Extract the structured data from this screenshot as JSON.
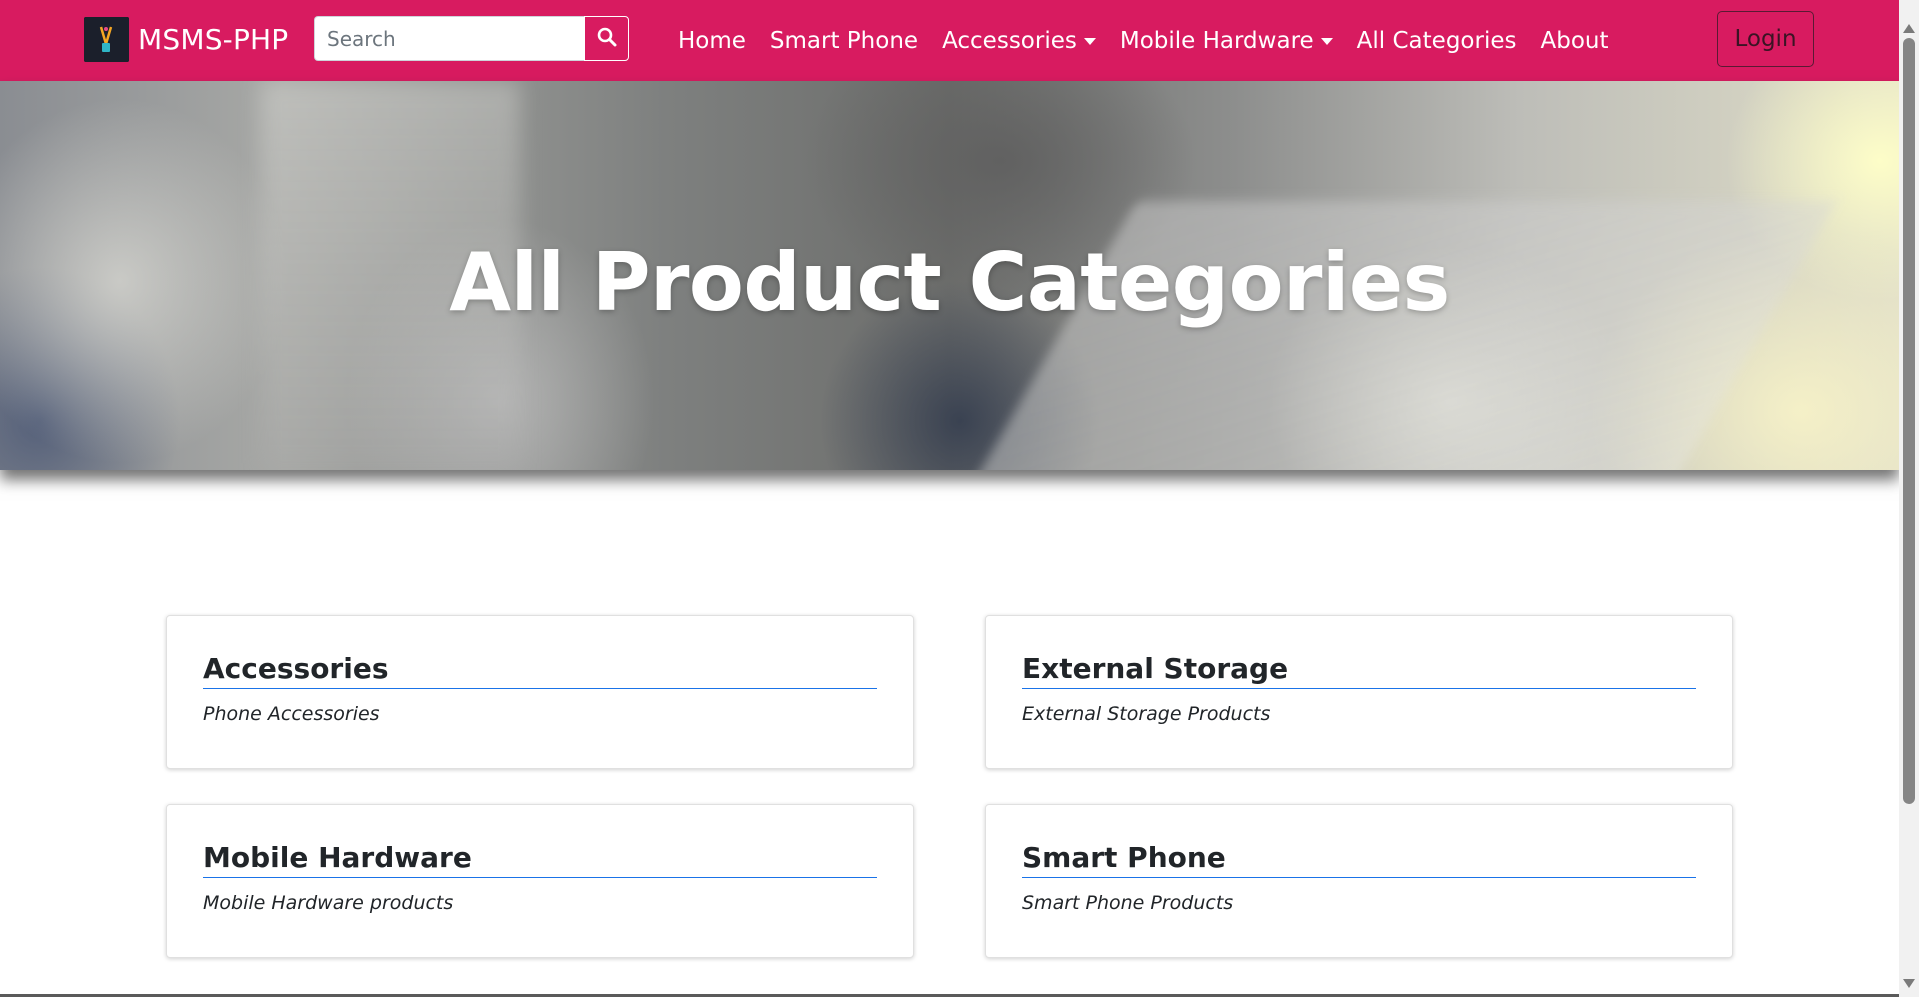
{
  "navbar": {
    "brand": "MSMS-PHP",
    "search": {
      "placeholder": "Search",
      "value": ""
    },
    "links": [
      {
        "label": "Home"
      },
      {
        "label": "Smart Phone"
      },
      {
        "label": "Accessories",
        "dropdown": true
      },
      {
        "label": "Mobile Hardware",
        "dropdown": true
      },
      {
        "label": "All Categories"
      },
      {
        "label": "About"
      }
    ],
    "login_label": "Login",
    "bg_color": "#d81b60"
  },
  "hero": {
    "title": "All Product Categories"
  },
  "categories": [
    {
      "title": "Accessories",
      "description": "Phone Accessories"
    },
    {
      "title": "External Storage",
      "description": "External Storage Products"
    },
    {
      "title": "Mobile Hardware",
      "description": "Mobile Hardware products"
    },
    {
      "title": "Smart Phone",
      "description": "Smart Phone Products"
    }
  ],
  "icons": {
    "brand_logo": "brand-logo-icon",
    "search": "search-icon",
    "caret": "caret-down-icon"
  }
}
